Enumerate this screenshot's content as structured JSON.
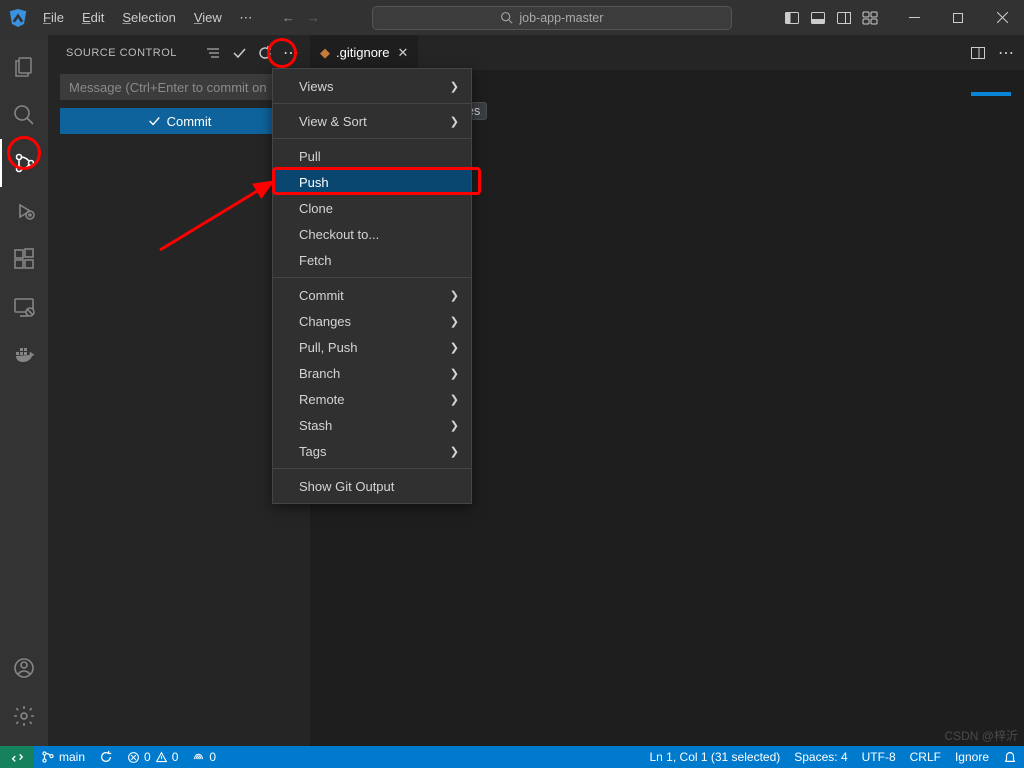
{
  "titlebar": {
    "menu": [
      "File",
      "Edit",
      "Selection",
      "View"
    ],
    "search_prefix_icon": "search",
    "search_text": "job-app-master"
  },
  "activity": {
    "items": [
      "files",
      "search",
      "scm",
      "debug",
      "extensions",
      "remote",
      "docker"
    ]
  },
  "sidebar": {
    "title": "SOURCE CONTROL",
    "commit_placeholder": "Message (Ctrl+Enter to commit on ",
    "commit_button": "Commit"
  },
  "tab": {
    "filename": ".gitignore"
  },
  "editor": {
    "token": "es"
  },
  "context_menu": [
    {
      "label": "Views",
      "sub": true
    },
    {
      "sep": true
    },
    {
      "label": "View & Sort",
      "sub": true
    },
    {
      "sep": true
    },
    {
      "label": "Pull"
    },
    {
      "label": "Push",
      "selected": true
    },
    {
      "label": "Clone"
    },
    {
      "label": "Checkout to..."
    },
    {
      "label": "Fetch"
    },
    {
      "sep": true
    },
    {
      "label": "Commit",
      "sub": true
    },
    {
      "label": "Changes",
      "sub": true
    },
    {
      "label": "Pull, Push",
      "sub": true
    },
    {
      "label": "Branch",
      "sub": true
    },
    {
      "label": "Remote",
      "sub": true
    },
    {
      "label": "Stash",
      "sub": true
    },
    {
      "label": "Tags",
      "sub": true
    },
    {
      "sep": true
    },
    {
      "label": "Show Git Output"
    }
  ],
  "status": {
    "branch": "main",
    "errors": "0",
    "warnings": "0",
    "ports": "0",
    "ln_col": "Ln 1, Col 1 (31 selected)",
    "spaces": "Spaces: 4",
    "encoding": "UTF-8",
    "eol": "CRLF",
    "lang": "Ignore"
  },
  "watermark": "CSDN @梓沂"
}
